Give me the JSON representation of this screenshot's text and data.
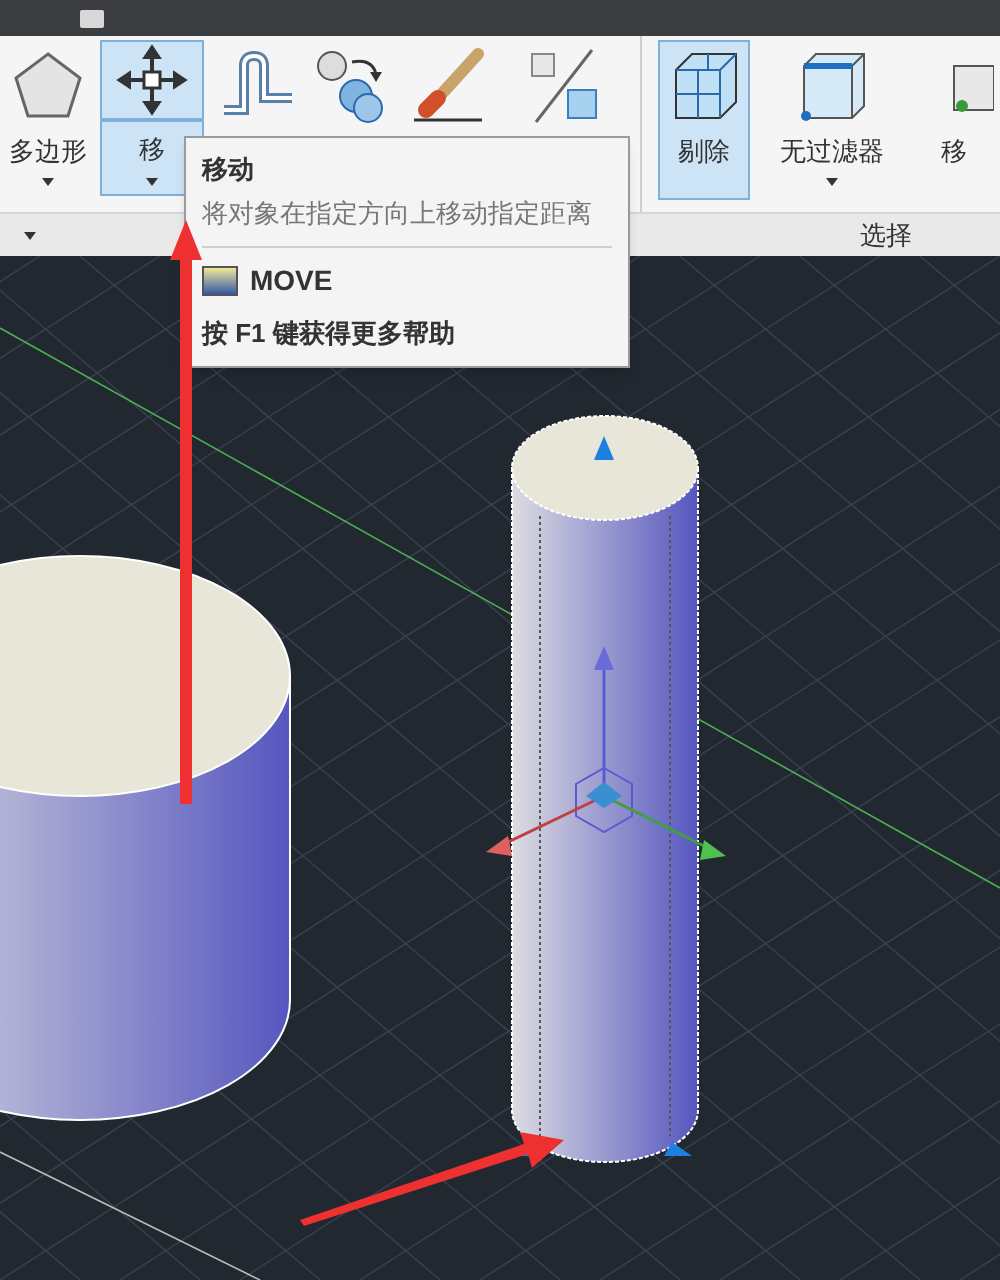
{
  "ribbon": {
    "buttons": [
      {
        "kind": "polygon",
        "label": "多边形",
        "dropdown": true,
        "selected": false
      },
      {
        "kind": "move",
        "label": "移",
        "dropdown": true,
        "selected": true
      },
      {
        "kind": "stretch",
        "selected": false
      },
      {
        "kind": "copy",
        "selected": false
      },
      {
        "kind": "erase",
        "selected": false
      },
      {
        "kind": "scale",
        "selected": false
      },
      {
        "kind": "separator"
      },
      {
        "kind": "cull",
        "label": "剔除",
        "selected": true
      },
      {
        "kind": "filter",
        "label": "无过滤器",
        "dropdown": true,
        "selected": false
      },
      {
        "kind": "gizmo",
        "label": "移",
        "selected": false
      }
    ],
    "panel_label": "选择"
  },
  "tooltip": {
    "title": "移动",
    "description": "将对象在指定方向上移动指定距离",
    "command": "MOVE",
    "help": "按 F1 键获得更多帮助"
  }
}
